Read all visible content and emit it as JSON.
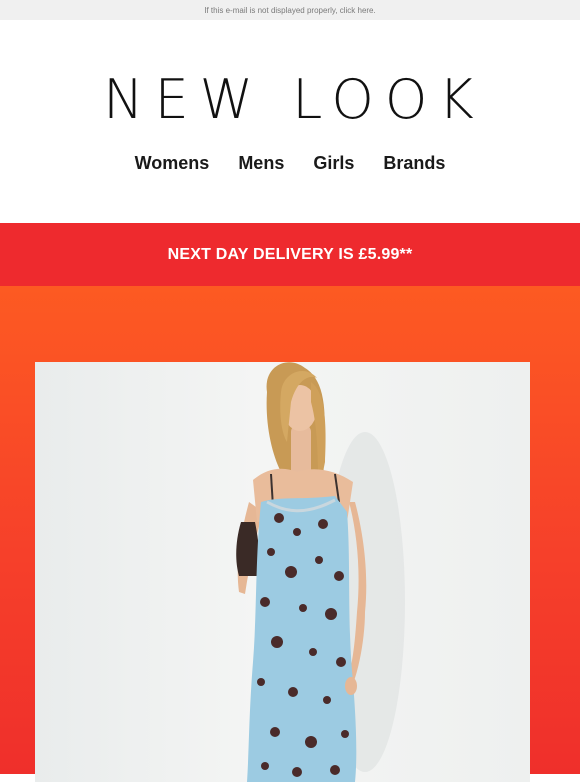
{
  "preheader": {
    "text": "If this e-mail is not displayed properly, click here."
  },
  "brand": {
    "logo_text": "NEW LOOK"
  },
  "nav": {
    "items": [
      {
        "label": "Womens"
      },
      {
        "label": "Mens"
      },
      {
        "label": "Girls"
      },
      {
        "label": "Brands"
      }
    ]
  },
  "promo_banner": {
    "text": "NEXT DAY DELIVERY IS £5.99**",
    "background": "#ee2a2e"
  },
  "hero": {
    "background_top": "#fd5a22",
    "background_bottom": "#ef2f2b",
    "image_subject": "model-in-blue-floral-slip-dress"
  }
}
